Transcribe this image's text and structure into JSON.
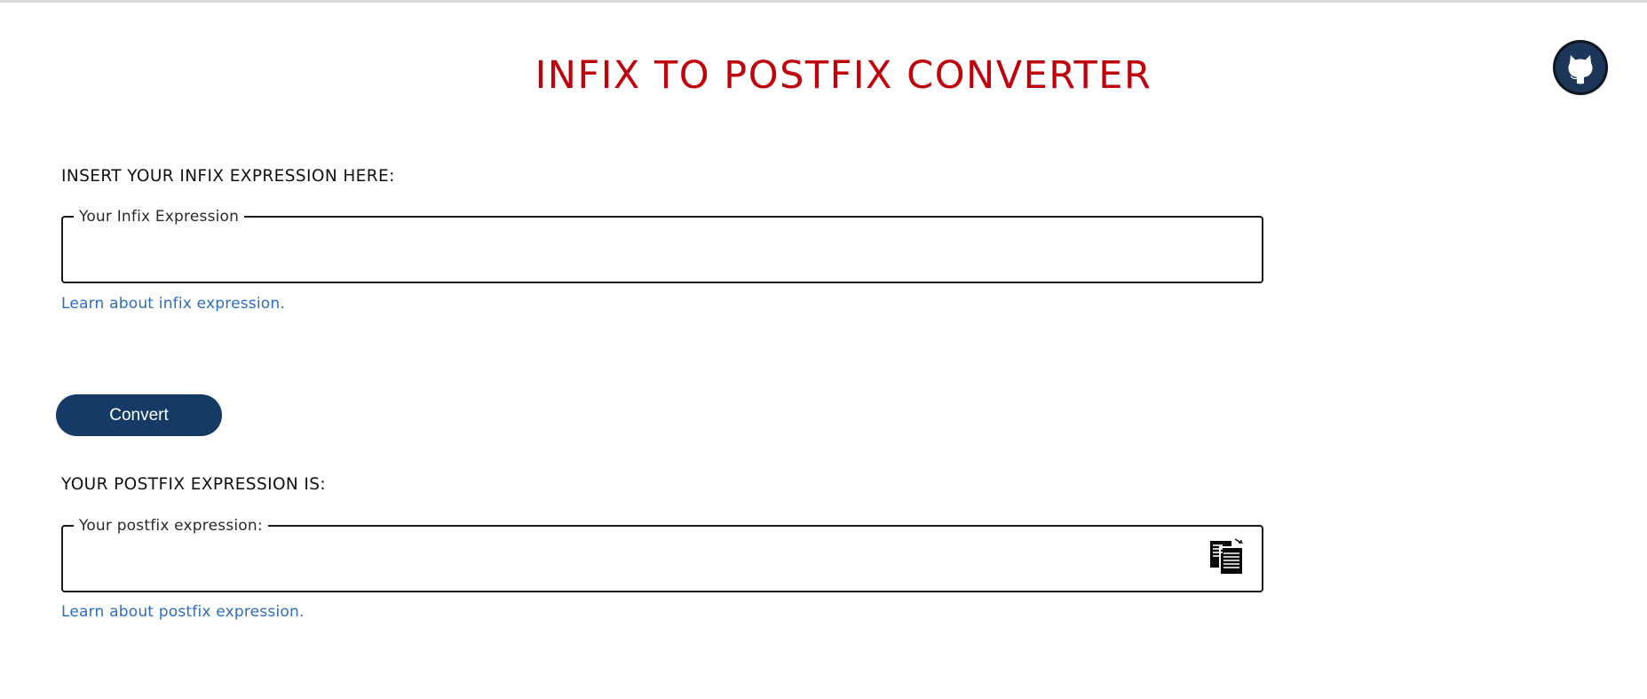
{
  "header": {
    "title": "INFIX TO POSTFIX CONVERTER",
    "github_icon": "github-icon"
  },
  "infix": {
    "section_label": "INSERT YOUR INFIX EXPRESSION HERE:",
    "field_legend": "Your Infix Expression",
    "value": "",
    "learn_link": "Learn about infix expression."
  },
  "convert": {
    "button_label": "Convert"
  },
  "postfix": {
    "section_label": "YOUR POSTFIX EXPRESSION IS:",
    "field_legend": "Your postfix expression:",
    "value": "",
    "copy_icon": "copy-icon",
    "learn_link": "Learn about postfix expression."
  },
  "colors": {
    "title": "#c0000a",
    "button": "#153a66",
    "link": "#2d6cc4",
    "github_bg": "#1b3658"
  }
}
